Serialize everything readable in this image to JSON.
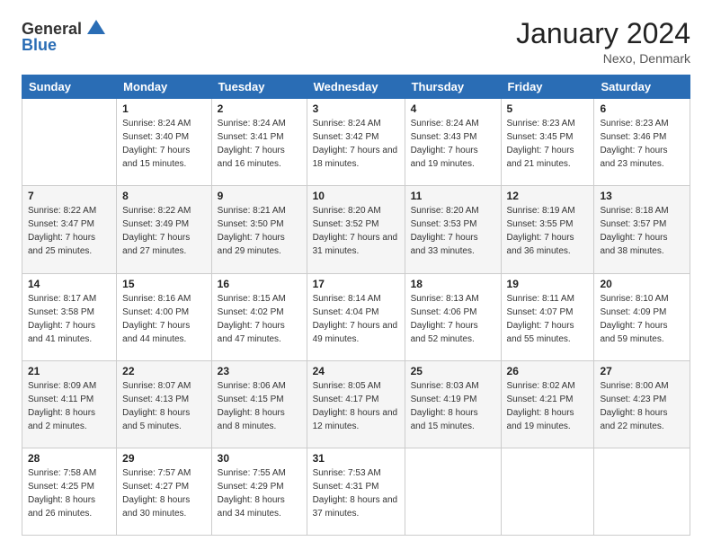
{
  "logo": {
    "general": "General",
    "blue": "Blue"
  },
  "header": {
    "title": "January 2024",
    "location": "Nexo, Denmark"
  },
  "columns": [
    "Sunday",
    "Monday",
    "Tuesday",
    "Wednesday",
    "Thursday",
    "Friday",
    "Saturday"
  ],
  "weeks": [
    [
      {
        "day": "",
        "sunrise": "",
        "sunset": "",
        "daylight": ""
      },
      {
        "day": "1",
        "sunrise": "Sunrise: 8:24 AM",
        "sunset": "Sunset: 3:40 PM",
        "daylight": "Daylight: 7 hours and 15 minutes."
      },
      {
        "day": "2",
        "sunrise": "Sunrise: 8:24 AM",
        "sunset": "Sunset: 3:41 PM",
        "daylight": "Daylight: 7 hours and 16 minutes."
      },
      {
        "day": "3",
        "sunrise": "Sunrise: 8:24 AM",
        "sunset": "Sunset: 3:42 PM",
        "daylight": "Daylight: 7 hours and 18 minutes."
      },
      {
        "day": "4",
        "sunrise": "Sunrise: 8:24 AM",
        "sunset": "Sunset: 3:43 PM",
        "daylight": "Daylight: 7 hours and 19 minutes."
      },
      {
        "day": "5",
        "sunrise": "Sunrise: 8:23 AM",
        "sunset": "Sunset: 3:45 PM",
        "daylight": "Daylight: 7 hours and 21 minutes."
      },
      {
        "day": "6",
        "sunrise": "Sunrise: 8:23 AM",
        "sunset": "Sunset: 3:46 PM",
        "daylight": "Daylight: 7 hours and 23 minutes."
      }
    ],
    [
      {
        "day": "7",
        "sunrise": "Sunrise: 8:22 AM",
        "sunset": "Sunset: 3:47 PM",
        "daylight": "Daylight: 7 hours and 25 minutes."
      },
      {
        "day": "8",
        "sunrise": "Sunrise: 8:22 AM",
        "sunset": "Sunset: 3:49 PM",
        "daylight": "Daylight: 7 hours and 27 minutes."
      },
      {
        "day": "9",
        "sunrise": "Sunrise: 8:21 AM",
        "sunset": "Sunset: 3:50 PM",
        "daylight": "Daylight: 7 hours and 29 minutes."
      },
      {
        "day": "10",
        "sunrise": "Sunrise: 8:20 AM",
        "sunset": "Sunset: 3:52 PM",
        "daylight": "Daylight: 7 hours and 31 minutes."
      },
      {
        "day": "11",
        "sunrise": "Sunrise: 8:20 AM",
        "sunset": "Sunset: 3:53 PM",
        "daylight": "Daylight: 7 hours and 33 minutes."
      },
      {
        "day": "12",
        "sunrise": "Sunrise: 8:19 AM",
        "sunset": "Sunset: 3:55 PM",
        "daylight": "Daylight: 7 hours and 36 minutes."
      },
      {
        "day": "13",
        "sunrise": "Sunrise: 8:18 AM",
        "sunset": "Sunset: 3:57 PM",
        "daylight": "Daylight: 7 hours and 38 minutes."
      }
    ],
    [
      {
        "day": "14",
        "sunrise": "Sunrise: 8:17 AM",
        "sunset": "Sunset: 3:58 PM",
        "daylight": "Daylight: 7 hours and 41 minutes."
      },
      {
        "day": "15",
        "sunrise": "Sunrise: 8:16 AM",
        "sunset": "Sunset: 4:00 PM",
        "daylight": "Daylight: 7 hours and 44 minutes."
      },
      {
        "day": "16",
        "sunrise": "Sunrise: 8:15 AM",
        "sunset": "Sunset: 4:02 PM",
        "daylight": "Daylight: 7 hours and 47 minutes."
      },
      {
        "day": "17",
        "sunrise": "Sunrise: 8:14 AM",
        "sunset": "Sunset: 4:04 PM",
        "daylight": "Daylight: 7 hours and 49 minutes."
      },
      {
        "day": "18",
        "sunrise": "Sunrise: 8:13 AM",
        "sunset": "Sunset: 4:06 PM",
        "daylight": "Daylight: 7 hours and 52 minutes."
      },
      {
        "day": "19",
        "sunrise": "Sunrise: 8:11 AM",
        "sunset": "Sunset: 4:07 PM",
        "daylight": "Daylight: 7 hours and 55 minutes."
      },
      {
        "day": "20",
        "sunrise": "Sunrise: 8:10 AM",
        "sunset": "Sunset: 4:09 PM",
        "daylight": "Daylight: 7 hours and 59 minutes."
      }
    ],
    [
      {
        "day": "21",
        "sunrise": "Sunrise: 8:09 AM",
        "sunset": "Sunset: 4:11 PM",
        "daylight": "Daylight: 8 hours and 2 minutes."
      },
      {
        "day": "22",
        "sunrise": "Sunrise: 8:07 AM",
        "sunset": "Sunset: 4:13 PM",
        "daylight": "Daylight: 8 hours and 5 minutes."
      },
      {
        "day": "23",
        "sunrise": "Sunrise: 8:06 AM",
        "sunset": "Sunset: 4:15 PM",
        "daylight": "Daylight: 8 hours and 8 minutes."
      },
      {
        "day": "24",
        "sunrise": "Sunrise: 8:05 AM",
        "sunset": "Sunset: 4:17 PM",
        "daylight": "Daylight: 8 hours and 12 minutes."
      },
      {
        "day": "25",
        "sunrise": "Sunrise: 8:03 AM",
        "sunset": "Sunset: 4:19 PM",
        "daylight": "Daylight: 8 hours and 15 minutes."
      },
      {
        "day": "26",
        "sunrise": "Sunrise: 8:02 AM",
        "sunset": "Sunset: 4:21 PM",
        "daylight": "Daylight: 8 hours and 19 minutes."
      },
      {
        "day": "27",
        "sunrise": "Sunrise: 8:00 AM",
        "sunset": "Sunset: 4:23 PM",
        "daylight": "Daylight: 8 hours and 22 minutes."
      }
    ],
    [
      {
        "day": "28",
        "sunrise": "Sunrise: 7:58 AM",
        "sunset": "Sunset: 4:25 PM",
        "daylight": "Daylight: 8 hours and 26 minutes."
      },
      {
        "day": "29",
        "sunrise": "Sunrise: 7:57 AM",
        "sunset": "Sunset: 4:27 PM",
        "daylight": "Daylight: 8 hours and 30 minutes."
      },
      {
        "day": "30",
        "sunrise": "Sunrise: 7:55 AM",
        "sunset": "Sunset: 4:29 PM",
        "daylight": "Daylight: 8 hours and 34 minutes."
      },
      {
        "day": "31",
        "sunrise": "Sunrise: 7:53 AM",
        "sunset": "Sunset: 4:31 PM",
        "daylight": "Daylight: 8 hours and 37 minutes."
      },
      {
        "day": "",
        "sunrise": "",
        "sunset": "",
        "daylight": ""
      },
      {
        "day": "",
        "sunrise": "",
        "sunset": "",
        "daylight": ""
      },
      {
        "day": "",
        "sunrise": "",
        "sunset": "",
        "daylight": ""
      }
    ]
  ]
}
